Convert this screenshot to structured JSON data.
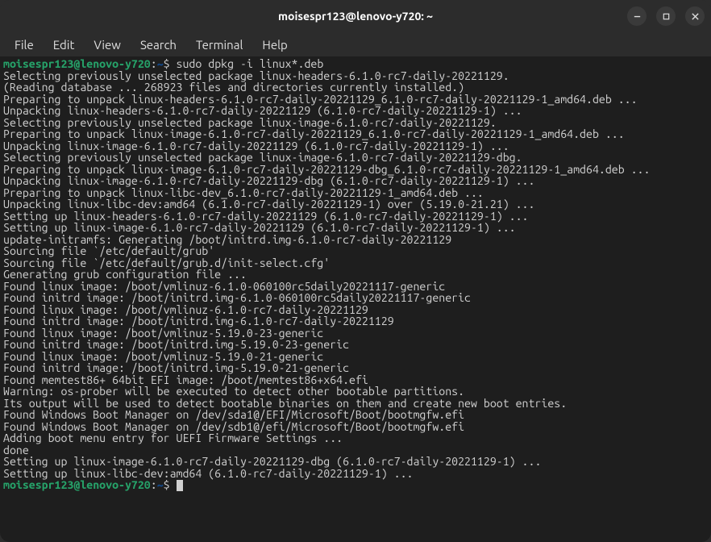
{
  "titlebar": {
    "title": "moisespr123@lenovo-y720: ~"
  },
  "menubar": {
    "file": "File",
    "edit": "Edit",
    "view": "View",
    "search": "Search",
    "terminal": "Terminal",
    "help": "Help"
  },
  "prompt": {
    "user": "moisespr123@lenovo-y720",
    "path": "~",
    "dollar": "$",
    "colon": ":"
  },
  "command": "sudo dpkg -i linux*.deb",
  "output": [
    "Selecting previously unselected package linux-headers-6.1.0-rc7-daily-20221129.",
    "(Reading database ... 268923 files and directories currently installed.)",
    "Preparing to unpack linux-headers-6.1.0-rc7-daily-20221129_6.1.0-rc7-daily-20221129-1_amd64.deb ...",
    "Unpacking linux-headers-6.1.0-rc7-daily-20221129 (6.1.0-rc7-daily-20221129-1) ...",
    "Selecting previously unselected package linux-image-6.1.0-rc7-daily-20221129.",
    "Preparing to unpack linux-image-6.1.0-rc7-daily-20221129_6.1.0-rc7-daily-20221129-1_amd64.deb ...",
    "Unpacking linux-image-6.1.0-rc7-daily-20221129 (6.1.0-rc7-daily-20221129-1) ...",
    "Selecting previously unselected package linux-image-6.1.0-rc7-daily-20221129-dbg.",
    "Preparing to unpack linux-image-6.1.0-rc7-daily-20221129-dbg_6.1.0-rc7-daily-20221129-1_amd64.deb ...",
    "Unpacking linux-image-6.1.0-rc7-daily-20221129-dbg (6.1.0-rc7-daily-20221129-1) ...",
    "Preparing to unpack linux-libc-dev_6.1.0-rc7-daily-20221129-1_amd64.deb ...",
    "Unpacking linux-libc-dev:amd64 (6.1.0-rc7-daily-20221129-1) over (5.19.0-21.21) ...",
    "Setting up linux-headers-6.1.0-rc7-daily-20221129 (6.1.0-rc7-daily-20221129-1) ...",
    "Setting up linux-image-6.1.0-rc7-daily-20221129 (6.1.0-rc7-daily-20221129-1) ...",
    "update-initramfs: Generating /boot/initrd.img-6.1.0-rc7-daily-20221129",
    "Sourcing file `/etc/default/grub'",
    "Sourcing file `/etc/default/grub.d/init-select.cfg'",
    "Generating grub configuration file ...",
    "Found linux image: /boot/vmlinuz-6.1.0-060100rc5daily20221117-generic",
    "Found initrd image: /boot/initrd.img-6.1.0-060100rc5daily20221117-generic",
    "Found linux image: /boot/vmlinuz-6.1.0-rc7-daily-20221129",
    "Found initrd image: /boot/initrd.img-6.1.0-rc7-daily-20221129",
    "Found linux image: /boot/vmlinuz-5.19.0-23-generic",
    "Found initrd image: /boot/initrd.img-5.19.0-23-generic",
    "Found linux image: /boot/vmlinuz-5.19.0-21-generic",
    "Found initrd image: /boot/initrd.img-5.19.0-21-generic",
    "Found memtest86+ 64bit EFI image: /boot/memtest86+x64.efi",
    "Warning: os-prober will be executed to detect other bootable partitions.",
    "Its output will be used to detect bootable binaries on them and create new boot entries.",
    "Found Windows Boot Manager on /dev/sda1@/EFI/Microsoft/Boot/bootmgfw.efi",
    "Found Windows Boot Manager on /dev/sdb1@/efi/Microsoft/Boot/bootmgfw.efi",
    "Adding boot menu entry for UEFI Firmware Settings ...",
    "done",
    "Setting up linux-image-6.1.0-rc7-daily-20221129-dbg (6.1.0-rc7-daily-20221129-1) ...",
    "Setting up linux-libc-dev:amd64 (6.1.0-rc7-daily-20221129-1) ..."
  ]
}
